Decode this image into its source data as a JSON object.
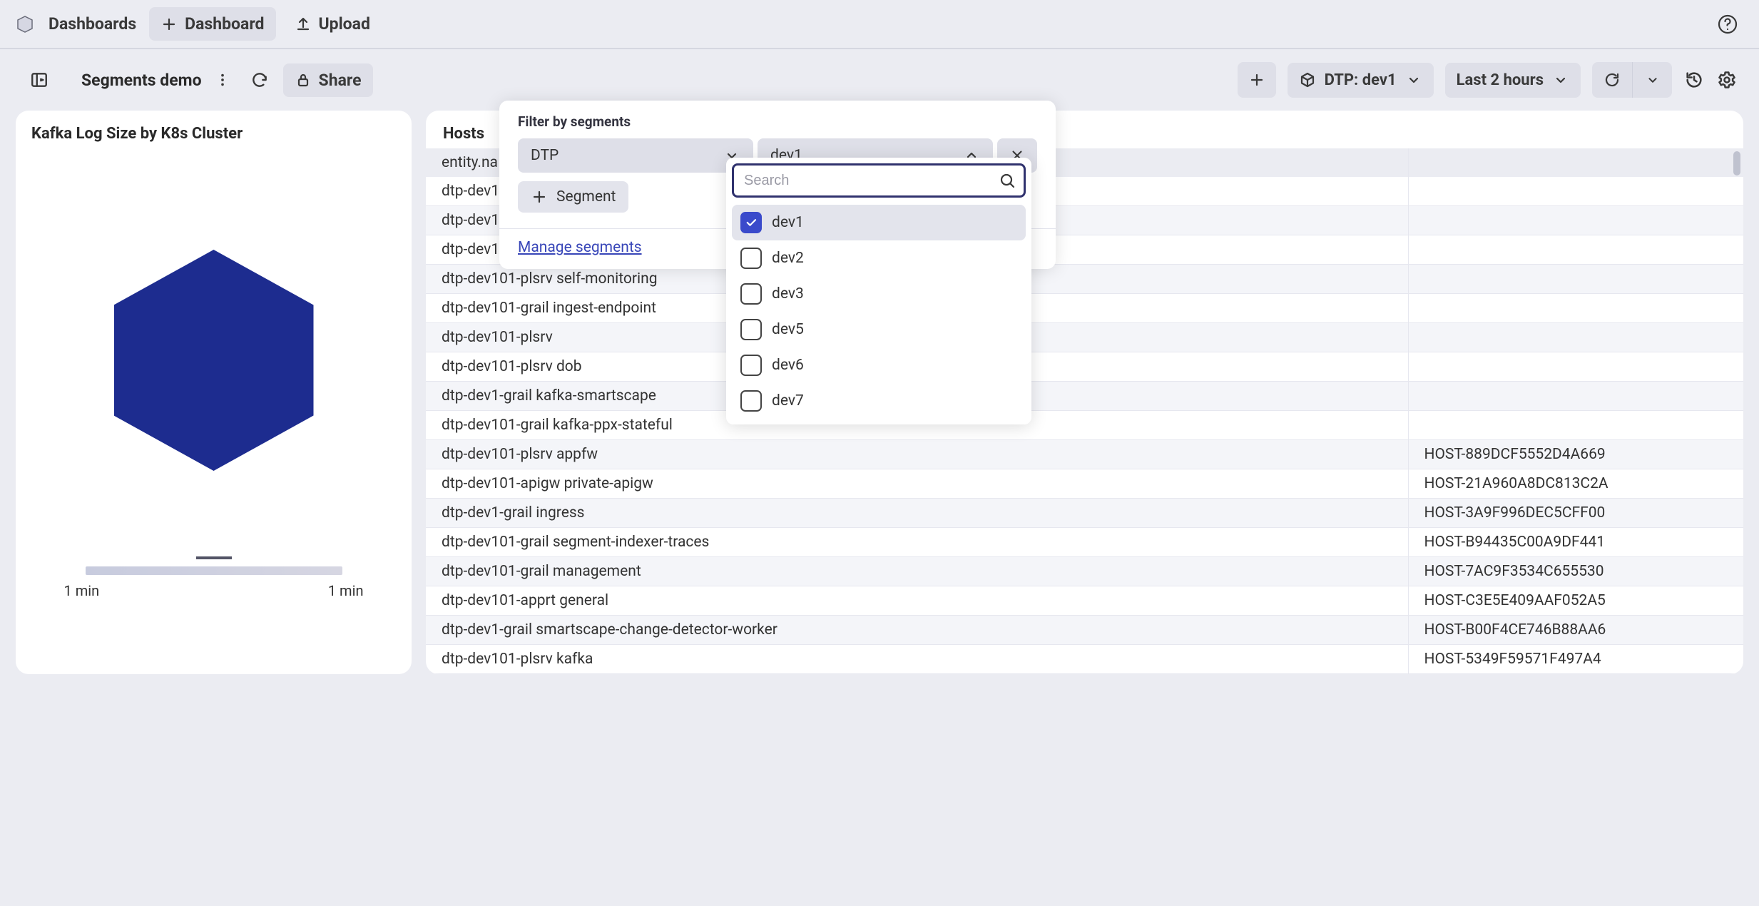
{
  "topbar": {
    "nav": "Dashboards",
    "dashboard_btn": "Dashboard",
    "upload_btn": "Upload"
  },
  "subbar": {
    "title": "Segments demo",
    "share_btn": "Share",
    "filter_label": "DTP: dev1",
    "timerange": "Last 2 hours"
  },
  "popover": {
    "title": "Filter by segments",
    "select1": "DTP",
    "select2": "dev1",
    "add_segment": "Segment",
    "manage_link": "Manage segments",
    "search_placeholder": "Search"
  },
  "dropdown_options": [
    {
      "label": "dev1",
      "checked": true
    },
    {
      "label": "dev2",
      "checked": false
    },
    {
      "label": "dev3",
      "checked": false
    },
    {
      "label": "dev5",
      "checked": false
    },
    {
      "label": "dev6",
      "checked": false
    },
    {
      "label": "dev7",
      "checked": false
    }
  ],
  "card_left": {
    "title": "Kafka Log Size by K8s Cluster",
    "legend_left": "1 min",
    "legend_right": "1 min"
  },
  "card_right": {
    "title": "Hosts",
    "col1": "entity.na",
    "rows": [
      {
        "c1": "dtp-dev1",
        "c2": ""
      },
      {
        "c1": "dtp-dev1",
        "c2": ""
      },
      {
        "c1": "dtp-dev1",
        "c2": ""
      },
      {
        "c1": "dtp-dev101-plsrv self-monitoring",
        "c2": ""
      },
      {
        "c1": "dtp-dev101-grail ingest-endpoint",
        "c2": ""
      },
      {
        "c1": "dtp-dev101-plsrv",
        "c2": ""
      },
      {
        "c1": "dtp-dev101-plsrv dob",
        "c2": ""
      },
      {
        "c1": "dtp-dev1-grail kafka-smartscape",
        "c2": ""
      },
      {
        "c1": "dtp-dev101-grail kafka-ppx-stateful",
        "c2": ""
      },
      {
        "c1": "dtp-dev101-plsrv appfw",
        "c2": "HOST-889DCF5552D4A669"
      },
      {
        "c1": "dtp-dev101-apigw private-apigw",
        "c2": "HOST-21A960A8DC813C2A"
      },
      {
        "c1": "dtp-dev1-grail ingress",
        "c2": "HOST-3A9F996DEC5CFF00"
      },
      {
        "c1": "dtp-dev101-grail segment-indexer-traces",
        "c2": "HOST-B94435C00A9DF441"
      },
      {
        "c1": "dtp-dev101-grail management",
        "c2": "HOST-7AC9F3534C655530"
      },
      {
        "c1": "dtp-dev101-apprt general",
        "c2": "HOST-C3E5E409AAF052A5"
      },
      {
        "c1": "dtp-dev1-grail smartscape-change-detector-worker",
        "c2": "HOST-B00F4CE746B88AA6"
      },
      {
        "c1": "dtp-dev101-plsrv kafka",
        "c2": "HOST-5349F59571F497A4"
      }
    ]
  }
}
